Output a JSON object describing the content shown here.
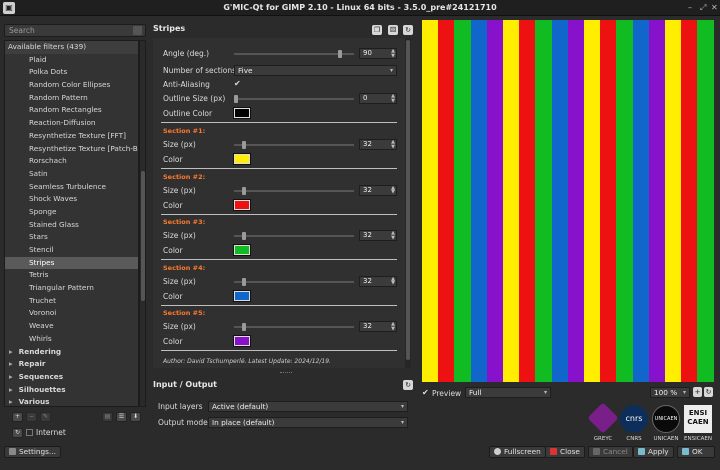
{
  "window": {
    "title": "G'MIC-Qt for GIMP 2.10 - Linux 64 bits - 3.5.0_pre#24121710",
    "controls": [
      "–",
      "⤢",
      "✕"
    ]
  },
  "search": {
    "placeholder": "Search"
  },
  "tree": {
    "root": "Available filters (439)",
    "items": [
      "Plaid",
      "Polka Dots",
      "Random Color Ellipses",
      "Random Pattern",
      "Random Rectangles",
      "Reaction-Diffusion",
      "Resynthetize Texture [FFT]",
      "Resynthetize Texture [Patch-Based]",
      "Rorschach",
      "Satin",
      "Seamless Turbulence",
      "Shock Waves",
      "Sponge",
      "Stained Glass",
      "Stars",
      "Stencil",
      "Stripes",
      "Tetris",
      "Triangular Pattern",
      "Truchet",
      "Voronoi",
      "Weave",
      "Whirls"
    ],
    "selected": "Stripes",
    "categories": [
      "Rendering",
      "Repair",
      "Sequences",
      "Silhouettes",
      "Various"
    ]
  },
  "left_bottom": {
    "internet_label": "Internet",
    "settings_label": "Settings..."
  },
  "filter": {
    "title": "Stripes",
    "angle": {
      "label": "Angle (deg.)",
      "value": "90",
      "fraction": 0.9
    },
    "sections": {
      "label": "Number of sections",
      "value": "Five"
    },
    "anti_aliasing": {
      "label": "Anti-Aliasing",
      "checked": "✔"
    },
    "outline_size": {
      "label": "Outline Size (px)",
      "value": "0",
      "fraction": 0
    },
    "outline_color": {
      "label": "Outline Color",
      "color": "#000000"
    },
    "section_list": [
      {
        "header": "Section #1:",
        "size_label": "Size (px)",
        "size": "32",
        "color_label": "Color",
        "color": "#ffee00"
      },
      {
        "header": "Section #2:",
        "size_label": "Size (px)",
        "size": "32",
        "color_label": "Color",
        "color": "#ee1111"
      },
      {
        "header": "Section #3:",
        "size_label": "Size (px)",
        "size": "32",
        "color_label": "Color",
        "color": "#11bb22"
      },
      {
        "header": "Section #4:",
        "size_label": "Size (px)",
        "size": "32",
        "color_label": "Color",
        "color": "#1166cc"
      },
      {
        "header": "Section #5:",
        "size_label": "Size (px)",
        "size": "32",
        "color_label": "Color",
        "color": "#8811cc"
      }
    ],
    "author": "Author: David Tschumperlé.    Latest Update: 2024/12/19."
  },
  "io": {
    "title": "Input / Output",
    "input_layers": {
      "label": "Input layers",
      "value": "Active (default)"
    },
    "output_mode": {
      "label": "Output mode",
      "value": "In place (default)"
    }
  },
  "preview": {
    "checkbox_label": "Preview",
    "mode": "Full",
    "zoom": "100 %",
    "stripe_colors": [
      "#ffee00",
      "#ee1111",
      "#11bb22",
      "#1166cc",
      "#8811cc"
    ]
  },
  "logos": [
    "GREYC",
    "CNRS",
    "UNICAEN",
    "ENSICAEN"
  ],
  "logo_marks": {
    "cnrs": "cnrs",
    "unicaen": "UNICAEN",
    "ensicaen": "ENSI CAEN"
  },
  "buttons": {
    "fullscreen": "Fullscreen",
    "close": "Close",
    "cancel": "Cancel",
    "apply": "Apply",
    "ok": "OK"
  }
}
